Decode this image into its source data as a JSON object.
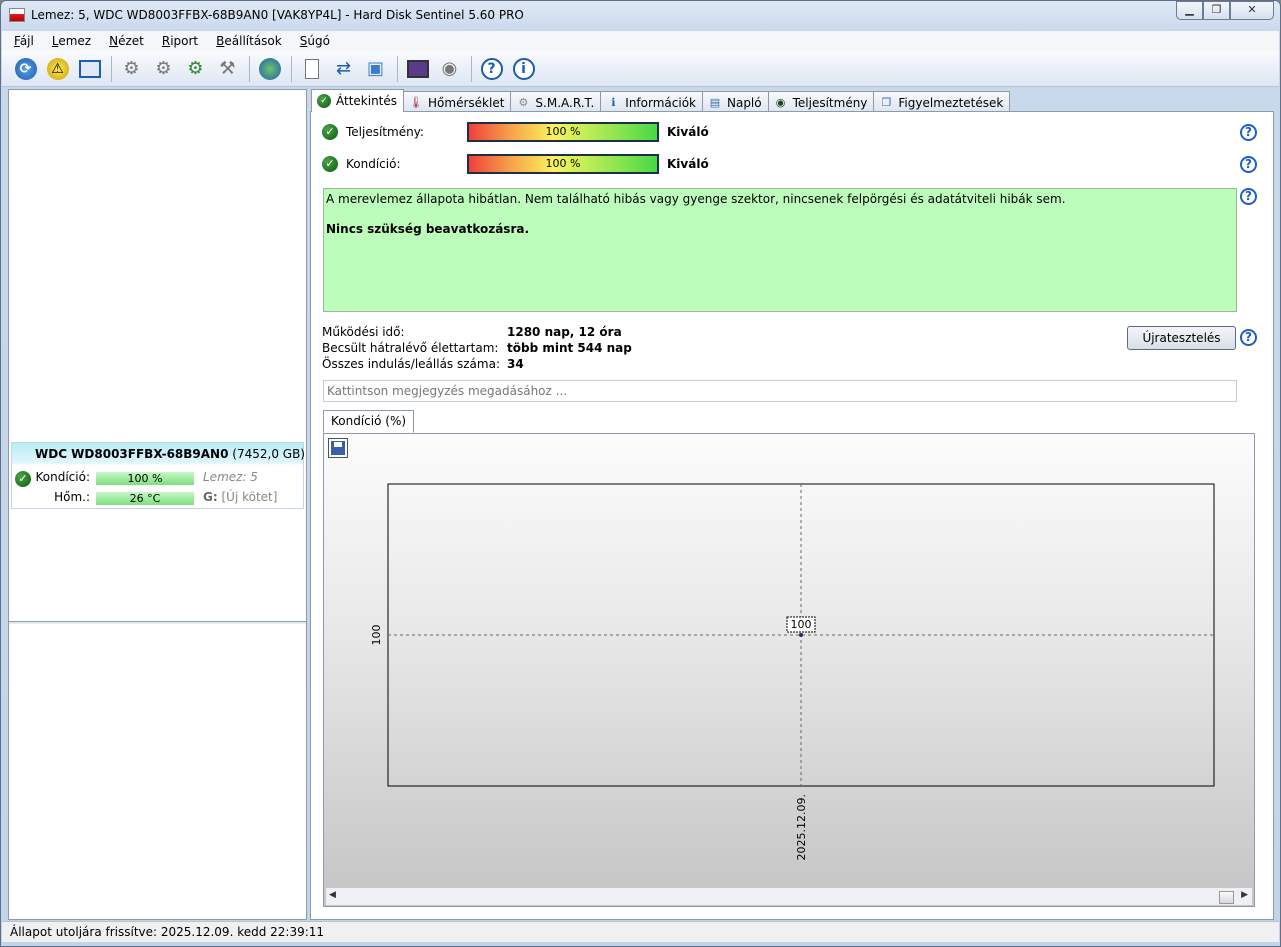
{
  "window": {
    "title": "Lemez: 5, WDC WD8003FFBX-68B9AN0 [VAK8YP4L]  -  Hard Disk Sentinel 5.60 PRO",
    "buttons": {
      "minimize": "▁",
      "maximize": "❐",
      "close": "✕"
    }
  },
  "menu": [
    "Fájl",
    "Lemez",
    "Nézet",
    "Riport",
    "Beállítások",
    "Súgó"
  ],
  "toolbar": {
    "icons": [
      "refresh-icon",
      "warning-icon",
      "disk-icon",
      "tool1-icon",
      "tool2-icon",
      "tool3-icon",
      "tool4-icon",
      "globe-icon",
      "report-icon",
      "sync-icon",
      "network-icon",
      "monitor-icon",
      "sound-icon",
      "help-icon",
      "info-icon"
    ]
  },
  "disk": {
    "name": "WDC WD8003FFBX-68B9AN0",
    "size": "(7452,0 GB)",
    "condition_label": "Kondíció:",
    "condition_value": "100 %",
    "disk_label": "Lemez: 5",
    "temp_label": "Hőm.:",
    "temp_value": "26 °C",
    "volume_letter": "G:",
    "volume_name": "[Új kötet]"
  },
  "tabs": [
    "Áttekintés",
    "Hőmérséklet",
    "S.M.A.R.T.",
    "Információk",
    "Napló",
    "Teljesítmény",
    "Figyelmeztetések"
  ],
  "overview": {
    "performance_label": "Teljesítmény:",
    "performance_value": "100 %",
    "performance_fraction": 1.0,
    "performance_result": "Kiváló",
    "condition_label": "Kondíció:",
    "condition_value": "100 %",
    "condition_fraction": 1.0,
    "condition_result": "Kiváló",
    "message": "A merevlemez állapota hibátlan. Nem található hibás vagy gyenge szektor, nincsenek felpörgési és adatátviteli hibák sem.",
    "message_bold": "Nincs szükség beavatkozásra.",
    "power_on_label": "Működési idő:",
    "power_on_value": "1280 nap, 12 óra",
    "lifetime_label": "Becsült hátralévő élettartam:",
    "lifetime_value": "több mint 544 nap",
    "starts_label": "Összes indulás/leállás száma:",
    "starts_value": "34",
    "retest_button": "Újratesztelés",
    "note_placeholder": "Kattintson megjegyzés megadásához ..."
  },
  "chart_tab": "Kondíció  (%)",
  "chart_data": {
    "type": "line",
    "x": [
      "2025.12.09."
    ],
    "series": [
      {
        "values": [
          100
        ]
      }
    ],
    "data_labels": [
      "100"
    ],
    "y_tick_labels": [
      "100"
    ],
    "x_tick_labels": [
      "2025.12.09."
    ],
    "grid": true
  },
  "status": "Állapot utoljára frissítve: 2025.12.09. kedd 22:39:11",
  "colors": {
    "message_bg": "#bdfdbb",
    "disk_bar": "#7ee07e",
    "check": "#0c5a0c",
    "help": "#1f5fc0"
  }
}
